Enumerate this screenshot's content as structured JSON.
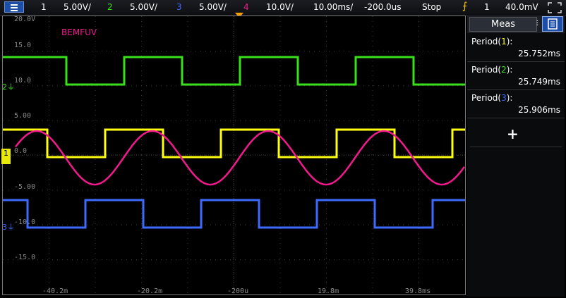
{
  "topbar": {
    "menu_icon": "menu-icon",
    "ch1_num": "1",
    "ch1_scale": "5.00V/",
    "ch2_num": "2",
    "ch2_scale": "5.00V/",
    "ch3_num": "3",
    "ch3_scale": "5.00V/",
    "ch4_num": "4",
    "ch4_scale": "10.0V/",
    "timebase": "10.00ms/",
    "delay": "-200.0us",
    "run_state": "Stop",
    "trigger_icon": "trigger-edge-icon",
    "trig_source": "1",
    "trig_level": "40.0mV",
    "fullscreen_icon": "fullscreen-icon"
  },
  "colors": {
    "ch1": "#ffff10",
    "ch2": "#38e01c",
    "ch3": "#3d6bff",
    "ch4": "#f01a8c",
    "grid": "#3a3a3a",
    "bg": "#000000"
  },
  "screen": {
    "waveform_label": "BEMFUV",
    "y_labels": [
      "20.0V",
      "15.0",
      "10.0",
      "5.00",
      "0.0",
      "-5.00",
      "-10.0",
      "-15.0"
    ],
    "x_labels": [
      "-40.2m",
      "-20.2m",
      "-200u",
      "19.8m",
      "39.8ms"
    ],
    "ch2_marker": "2",
    "ch1_marker": "1",
    "ch3_marker": "3"
  },
  "side": {
    "tab_label": "Meas",
    "measurements": [
      {
        "pre": "Period(",
        "ch": "1",
        "post": "):",
        "value": "25.752ms"
      },
      {
        "pre": "Period(",
        "ch": "2",
        "post": "):",
        "value": "25.749ms"
      },
      {
        "pre": "Period(",
        "ch": "3",
        "post": "):",
        "value": "25.906ms"
      }
    ],
    "add_label": "+"
  }
}
